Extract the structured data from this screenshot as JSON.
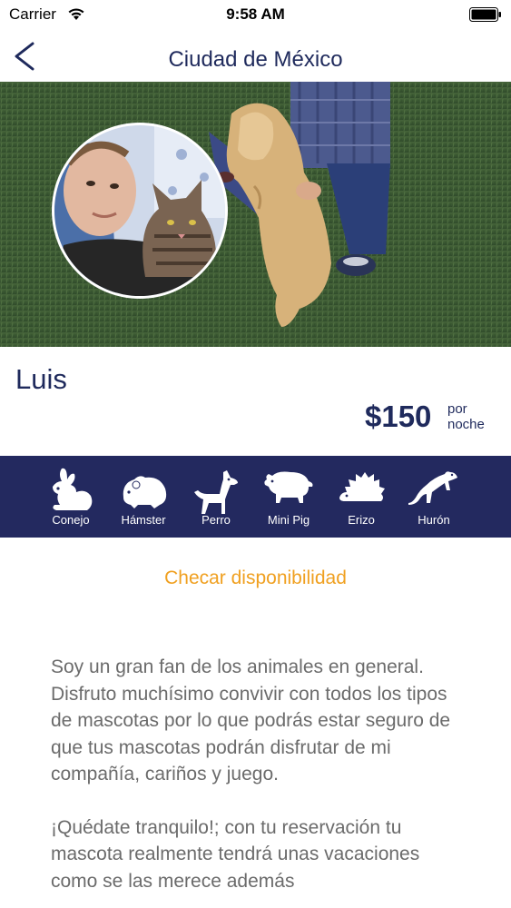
{
  "status_bar": {
    "carrier": "Carrier",
    "time": "9:58 AM"
  },
  "nav": {
    "title": "Ciudad de México",
    "back_icon": "chevron-left-icon"
  },
  "host": {
    "name": "Luis",
    "price": "$150",
    "price_unit_line1": "por",
    "price_unit_line2": "noche"
  },
  "pets": [
    {
      "label": "Conejo",
      "icon": "rabbit-icon"
    },
    {
      "label": "Hámster",
      "icon": "hamster-icon"
    },
    {
      "label": "Perro",
      "icon": "dog-icon"
    },
    {
      "label": "Mini Pig",
      "icon": "pig-icon"
    },
    {
      "label": "Erizo",
      "icon": "hedgehog-icon"
    },
    {
      "label": "Hurón",
      "icon": "ferret-icon"
    }
  ],
  "availability_label": "Checar disponibilidad",
  "bio": {
    "paragraph1": "Soy un gran fan de los animales en general. Disfruto muchísimo convivir con todos los tipos de mascotas por lo que podrás estar seguro de que tus mascotas podrán disfrutar de mi compañía, cariños y juego.",
    "paragraph2": "¡Quédate tranquilo!; con tu reservación tu mascota realmente tendrá unas vacaciones como se las merece además"
  },
  "colors": {
    "navy": "#23295f",
    "title_text": "#1f2a5c",
    "accent_orange": "#f0a020",
    "body_text": "#6b6b6b"
  }
}
